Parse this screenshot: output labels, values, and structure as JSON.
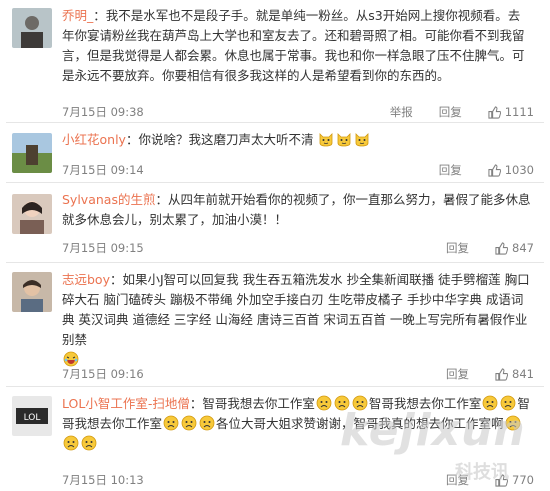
{
  "comments": [
    {
      "username": "乔明_",
      "text": "：我不是水军也不是段子手。就是单纯一粉丝。从s3开始网上搜你视频看。去年你宴请粉丝我在葫芦岛上大学也和室友去了。还和碧哥照了相。可能你看不到我留言，但是我觉得是人都会累。休息也属于常事。我也和你一样急眼了压不住脾气。可是永远不要放弃。你要相信有很多我这样的人是希望看到你的东西的。",
      "time": "7月15日 09:38",
      "report": "举报",
      "reply": "回复",
      "likes": "1111"
    },
    {
      "username": "小红花only",
      "text": "：你说啥？我这磨刀声太大听不清",
      "emoji_count": 3,
      "time": "7月15日 09:14",
      "reply": "回复",
      "likes": "1030"
    },
    {
      "username": "Sylvanas的生煎",
      "text": "：从四年前就开始看你的视频了，你一直那么努力，暑假了能多休息就多休息会儿，别太累了，加油小漠！！",
      "time": "7月15日 09:15",
      "reply": "回复",
      "likes": "847"
    },
    {
      "username": "志远boy",
      "text": "：如果小J智可以回复我 我生吞五箱洗发水 抄全集新闻联播 徒手劈榴莲 胸口碎大石 脑门磕砖头 蹦极不带绳 外加空手接白刃 生吃带皮橘子 手抄中华字典 成语词典 英汉词典 道德经 三字经 山海经 唐诗三百首 宋词五百首 一晚上写完所有暑假作业 别禁",
      "time": "7月15日 09:16",
      "reply": "回复",
      "likes": "841"
    },
    {
      "username": "LOL小智工作室-扫地僧",
      "text_parts": [
        "：智哥我想去你工作室",
        "智哥我想去你工作室",
        "智哥我想去你工作室",
        "各位大哥大姐求赞谢谢，智哥我真的想去你工作室啊"
      ],
      "time": "7月15日 10:13",
      "reply": "回复",
      "likes": "770"
    }
  ],
  "watermark": "kejixun",
  "watermark_cn": "科技讯",
  "colors": {
    "username": "#eb7350",
    "meta": "#808080",
    "text": "#333333"
  }
}
